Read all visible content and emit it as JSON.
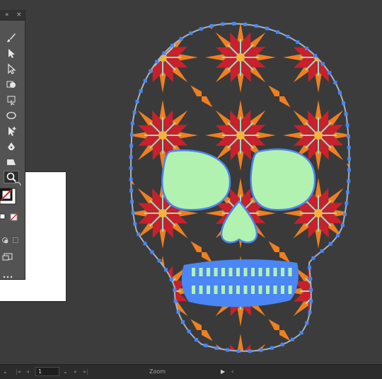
{
  "tools_panel": {
    "collapse_glyph": "«",
    "close_glyph": "×",
    "icons": [
      "paintbrush-icon",
      "selection-arrow-icon",
      "direct-selection-icon",
      "shape-builder-icon",
      "artboard-icon",
      "ellipse-icon",
      "puppet-warp-icon",
      "pen-icon",
      "shaper-icon",
      "zoom-icon"
    ]
  },
  "colors": {
    "app_bg": "#3a3a3a",
    "panel_bg": "#535353",
    "selection_blue": "#4a86f5",
    "eye_fill": "#b2f2b0",
    "pattern_red": "#c8202c",
    "pattern_orange": "#f07f1f",
    "pattern_mint": "#8fe0c0",
    "skull_bg": "#3a3a3a"
  },
  "status_bar": {
    "page_number": "1",
    "status_label": "Zoom"
  }
}
